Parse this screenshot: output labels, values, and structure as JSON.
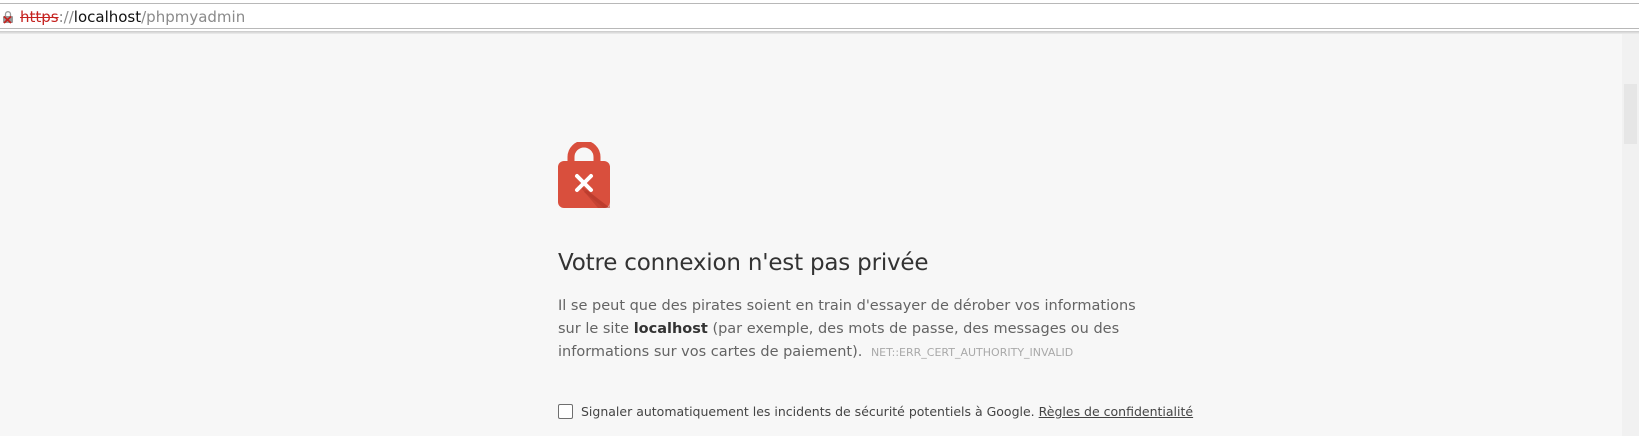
{
  "address_bar": {
    "scheme": "https",
    "separator": "://",
    "host": "localhost",
    "path": "/phpmyadmin",
    "security_icon": "not-secure-lock-icon"
  },
  "interstitial": {
    "icon": "red-lock-x-icon",
    "heading": "Votre connexion n'est pas privée",
    "paragraph_part1": "Il se peut que des pirates soient en train d'essayer de dérober vos informations sur le site",
    "paragraph_host": "localhost",
    "paragraph_part2": "(par exemple, des mots de passe, des messages ou des informations sur vos cartes de paiement).",
    "error_code": "NET::ERR_CERT_AUTHORITY_INVALID",
    "report_label": "Signaler automatiquement les incidents de sécurité potentiels à Google.",
    "privacy_link": "Règles de confidentialité",
    "report_checked": false
  },
  "colors": {
    "lock_red": "#d94f3d",
    "lock_red_dark": "#b73a2b",
    "page_bg": "#f7f7f7",
    "scheme_red": "#c5221f"
  }
}
